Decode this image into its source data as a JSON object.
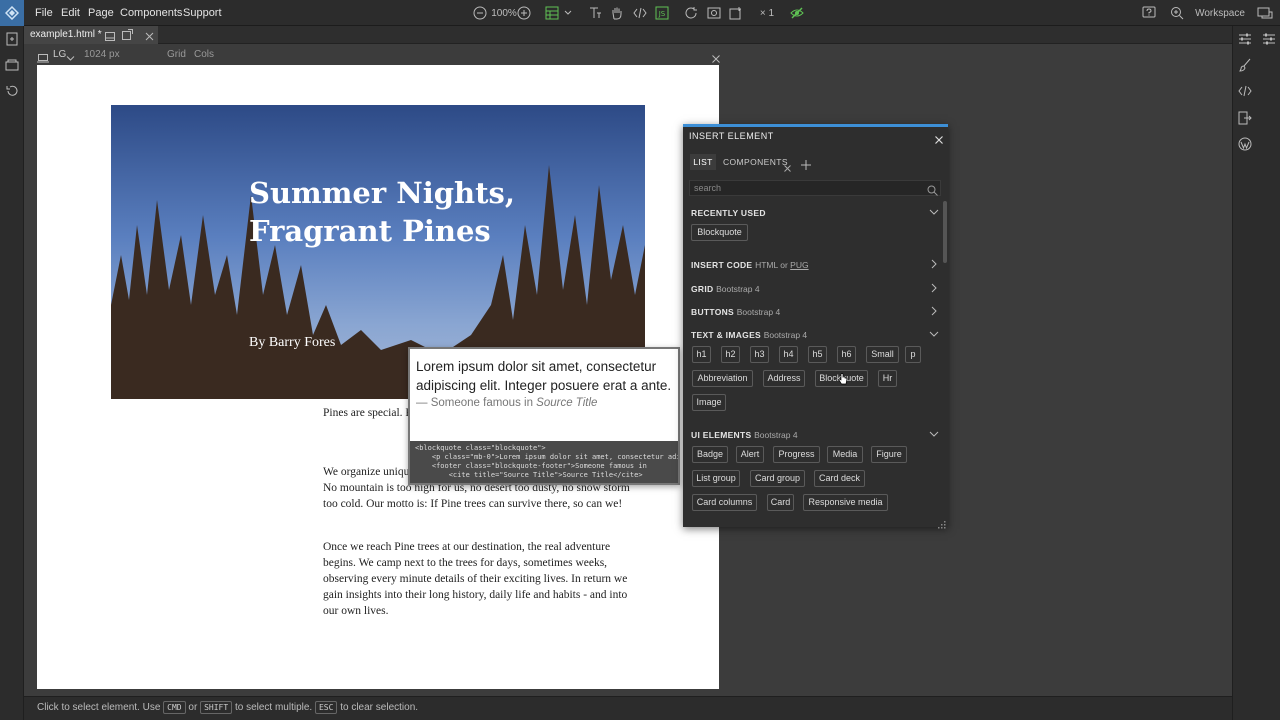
{
  "menu": {
    "file": "File",
    "edit": "Edit",
    "page": "Page",
    "components": "Components",
    "support": "Support"
  },
  "toolbar": {
    "zoom": "100%",
    "multiplier": "× 1",
    "workspace": "Workspace"
  },
  "file_tab": {
    "name": "example1.html *"
  },
  "viewport": {
    "size_label": "LG",
    "width": "1024 px",
    "grid": "Grid",
    "cols": "Cols"
  },
  "document": {
    "hero_title_line1": "Summer Nights,",
    "hero_title_line2": "Fragrant Pines",
    "byline": "By Barry Fores",
    "para1": "Pines are special.  Earth. Did you kno - and still growing today?",
    "para2": "We organize unique journeys to the Pine trees. Pine trees on the way. No mountain is too high for us, no desert too dusty, no snow storm too cold. Our motto is: If Pine trees can survive there, so can we!",
    "para3": "Once we reach Pine trees at our destination, the real adventure begins. We camp next to the trees for days, sometimes weeks, observing every minute details of their exciting lives. In return we gain insights into their long history, daily life and habits - and into our own lives."
  },
  "preview": {
    "quote": "Lorem ipsum dolor sit amet, consectetur adipiscing elit. Integer posuere erat a ante.",
    "footer_prefix": "— Someone famous in ",
    "footer_cite": "Source Title",
    "code": "<blockquote class=\"blockquote\">\n    <p class=\"mb-0\">Lorem ipsum dolor sit amet, consectetur adipi\n    <footer class=\"blockquote-footer\">Someone famous in\n        <cite title=\"Source Title\">Source Title</cite>"
  },
  "panel": {
    "title": "INSERT ELEMENT",
    "tab_list": "LIST",
    "tab_components": "COMPONENTS",
    "search_placeholder": "search",
    "recently_used": "RECENTLY USED",
    "recent_items": [
      "Blockquote"
    ],
    "insert_code": "INSERT CODE",
    "insert_code_sub": "HTML or ",
    "insert_code_pug": "PUG",
    "grid": "GRID",
    "grid_sub": "Bootstrap 4",
    "buttons": "BUTTONS",
    "buttons_sub": "Bootstrap 4",
    "text_images": "TEXT & IMAGES",
    "text_images_sub": "Bootstrap 4",
    "text_items": [
      "h1",
      "h2",
      "h3",
      "h4",
      "h5",
      "h6",
      "Small",
      "p",
      "Abbreviation",
      "Address",
      "Blockquote",
      "Hr",
      "Image"
    ],
    "ui_elements": "UI ELEMENTS",
    "ui_elements_sub": "Bootstrap 4",
    "ui_items": [
      "Badge",
      "Alert",
      "Progress",
      "Media",
      "Figure",
      "List group",
      "Card group",
      "Card deck",
      "Card columns",
      "Card",
      "Responsive media"
    ]
  },
  "status": {
    "text1": "Click to select element. Use ",
    "kbd1": "CMD",
    "text2": " or ",
    "kbd2": "SHIFT",
    "text3": " to select multiple. ",
    "kbd3": "ESC",
    "text4": " to clear selection."
  },
  "colors": {
    "accent": "#3d8fd6",
    "active_green": "#5fc254",
    "panel_bg": "#2e2e2e",
    "chrome_bg": "#2c2c2c"
  }
}
